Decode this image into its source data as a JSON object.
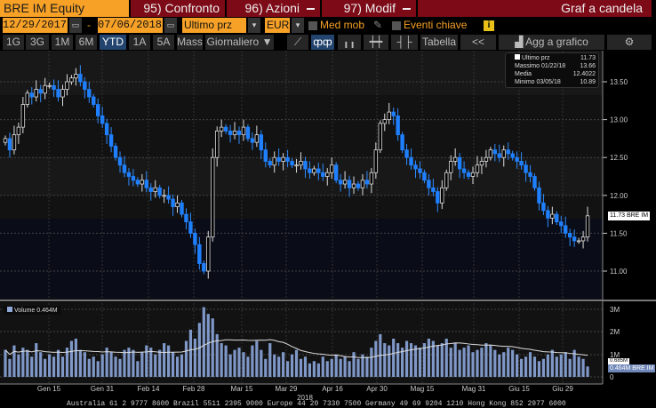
{
  "header": {
    "ticker": "BRE IM Equity",
    "compare": "95) Confronto",
    "actions": "96) Azioni",
    "edit": "97) Modif",
    "chart_type": "Graf a candela"
  },
  "controls": {
    "start_date": "12/29/2017",
    "separator": "-",
    "end_date": "07/06/2018",
    "field": "Ultimo prz",
    "currency": "EUR",
    "moving_avg": "Med mob",
    "key_events": "Eventi chiave",
    "info": "i"
  },
  "periods": [
    "1G",
    "3G",
    "1M",
    "6M",
    "YTD",
    "1A",
    "5A",
    "Mass"
  ],
  "selected_period": "YTD",
  "frequency": "Giornaliero",
  "toolbar": {
    "table": "Tabella",
    "collapse": "<<",
    "add_to_chart": "Agg a grafico"
  },
  "legend": {
    "last_label": "Ultimo prz",
    "last_value": "11.73",
    "max_label": "Massimo 01/22/18",
    "max_value": "13.66",
    "avg_label": "Media",
    "avg_value": "12.4022",
    "min_label": "Minimo 03/05/18",
    "min_value": "10.89"
  },
  "price_tag": "11.73 BRE IM",
  "volume": {
    "label": "Volume 0.464M",
    "tag": "0.464M BRE IM",
    "ma_tag": "0.685M"
  },
  "footer": "Australia 61 2 9777 8600 Brazil 5511 2395 9000 Europe 44 20 7330 7500 Germany 49 69 9204 1210 Hong Kong 852 2977 6000",
  "chart_data": {
    "type": "candlestick",
    "title": "BRE IM Equity",
    "x_ticks": [
      "Gen 15",
      "Gen 31",
      "Feb 14",
      "Feb 28",
      "Mar 15",
      "Mar 29",
      "Apr 16",
      "Apr 30",
      "Mag 15",
      "Mag 31",
      "Giu 15",
      "Giu 29"
    ],
    "x_year": "2018",
    "price_ticks": [
      "13.50",
      "13.00",
      "12.50",
      "12.00",
      "11.50",
      "11.00"
    ],
    "price_ylim": [
      10.6,
      13.9
    ],
    "volume_ticks": [
      "3M",
      "2M",
      "1M",
      "0"
    ],
    "volume_ylim": [
      0,
      3.3
    ],
    "close": [
      12.75,
      12.6,
      12.8,
      12.9,
      13.2,
      13.35,
      13.3,
      13.4,
      13.35,
      13.45,
      13.45,
      13.4,
      13.3,
      13.4,
      13.5,
      13.55,
      13.6,
      13.5,
      13.4,
      13.3,
      13.2,
      13.05,
      12.95,
      12.8,
      12.65,
      12.5,
      12.4,
      12.3,
      12.25,
      12.2,
      12.15,
      12.2,
      12.1,
      12.05,
      12.1,
      12.0,
      12.0,
      11.95,
      11.85,
      11.9,
      11.75,
      11.65,
      11.5,
      11.35,
      11.1,
      11.0,
      11.45,
      12.5,
      12.85,
      12.9,
      12.85,
      12.8,
      12.85,
      12.8,
      12.9,
      12.75,
      12.7,
      12.8,
      12.6,
      12.45,
      12.4,
      12.5,
      12.45,
      12.5,
      12.45,
      12.4,
      12.4,
      12.45,
      12.35,
      12.3,
      12.35,
      12.3,
      12.25,
      12.3,
      12.4,
      12.2,
      12.15,
      12.2,
      12.1,
      12.15,
      12.1,
      12.2,
      12.15,
      12.3,
      12.6,
      12.95,
      13.0,
      13.1,
      13.05,
      12.8,
      12.6,
      12.5,
      12.4,
      12.35,
      12.3,
      12.2,
      12.1,
      12.05,
      11.9,
      12.1,
      12.3,
      12.45,
      12.5,
      12.35,
      12.3,
      12.25,
      12.3,
      12.4,
      12.45,
      12.5,
      12.6,
      12.55,
      12.5,
      12.6,
      12.55,
      12.5,
      12.45,
      12.4,
      12.3,
      12.25,
      12.1,
      11.9,
      11.8,
      11.7,
      11.75,
      11.65,
      11.6,
      11.5,
      11.45,
      11.4,
      11.4,
      11.45,
      11.73
    ],
    "volume_m": [
      1.2,
      0.8,
      1.4,
      1.0,
      1.3,
      1.2,
      0.9,
      1.5,
      1.1,
      0.8,
      1.0,
      0.9,
      1.2,
      0.9,
      1.3,
      1.6,
      1.7,
      1.2,
      1.1,
      0.8,
      0.9,
      0.7,
      1.0,
      1.3,
      1.1,
      0.9,
      0.8,
      1.2,
      1.3,
      1.2,
      0.7,
      1.1,
      1.4,
      1.3,
      1.0,
      1.2,
      1.5,
      1.4,
      1.1,
      0.9,
      1.0,
      1.6,
      2.1,
      1.7,
      2.4,
      3.1,
      2.8,
      2.6,
      1.9,
      1.5,
      1.4,
      1.0,
      1.2,
      1.3,
      1.1,
      0.9,
      1.4,
      1.6,
      1.2,
      0.8,
      1.5,
      1.0,
      0.9,
      1.1,
      0.7,
      1.0,
      1.2,
      0.8,
      0.9,
      0.6,
      0.7,
      0.6,
      0.9,
      0.7,
      0.8,
      1.0,
      0.8,
      0.9,
      0.7,
      1.1,
      0.8,
      1.0,
      0.9,
      1.3,
      1.6,
      1.9,
      1.5,
      1.4,
      1.7,
      1.5,
      1.3,
      1.6,
      1.5,
      1.4,
      1.3,
      1.5,
      1.7,
      1.6,
      1.4,
      1.5,
      1.7,
      1.3,
      1.5,
      1.2,
      1.3,
      1.4,
      1.1,
      1.2,
      1.3,
      1.5,
      1.4,
      1.2,
      1.0,
      1.1,
      1.3,
      1.2,
      1.0,
      0.8,
      0.9,
      1.1,
      0.9,
      0.7,
      0.8,
      1.0,
      1.2,
      0.9,
      1.0,
      1.1,
      0.8,
      1.2,
      0.9,
      0.8,
      0.464
    ]
  }
}
